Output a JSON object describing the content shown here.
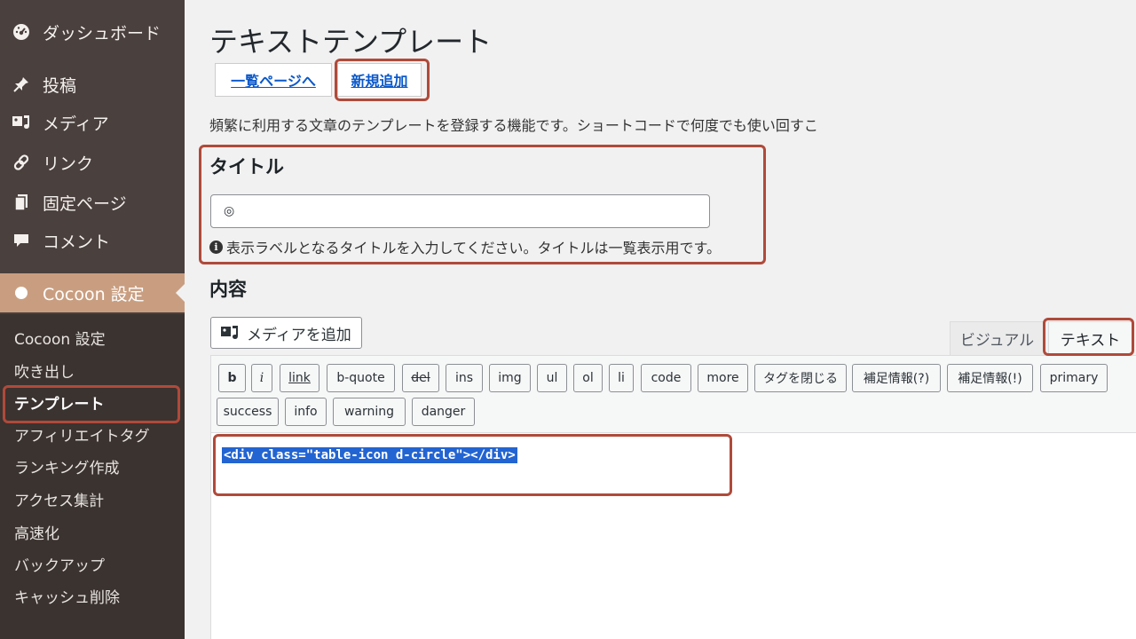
{
  "sidebar": {
    "items": [
      {
        "label": "ダッシュボード",
        "icon": "dashboard-icon"
      },
      {
        "label": "投稿",
        "icon": "pin-icon"
      },
      {
        "label": "メディア",
        "icon": "media-icon"
      },
      {
        "label": "リンク",
        "icon": "link-icon"
      },
      {
        "label": "固定ページ",
        "icon": "page-icon"
      },
      {
        "label": "コメント",
        "icon": "comment-icon"
      },
      {
        "label": "Cocoon 設定",
        "icon": "cocoon-icon"
      }
    ],
    "submenu": [
      "Cocoon 設定",
      "吹き出し",
      "テンプレート",
      "アフィリエイトタグ",
      "ランキング作成",
      "アクセス集計",
      "高速化",
      "バックアップ",
      "キャッシュ削除"
    ],
    "active_color": "#c99e80"
  },
  "main": {
    "title": "テキストテンプレート",
    "nav": {
      "list_link": "一覧ページへ",
      "add_new": "新規追加"
    },
    "description": "頻繁に利用する文章のテンプレートを登録する機能です。ショートコードで何度でも使い回すこ",
    "title_section": {
      "label": "タイトル",
      "value": "◎",
      "hint": "表示ラベルとなるタイトルを入力してください。タイトルは一覧表示用です。"
    },
    "content_section": {
      "label": "内容",
      "media_button": "メディアを追加",
      "tabs": {
        "visual": "ビジュアル",
        "text": "テキスト"
      },
      "toolbar": [
        "b",
        "i",
        "link",
        "b-quote",
        "del",
        "ins",
        "img",
        "ul",
        "ol",
        "li",
        "code",
        "more",
        "タグを閉じる",
        "補足情報(?)",
        "補足情報(!)",
        "primary",
        "success",
        "info",
        "warning",
        "danger"
      ],
      "editor_content": "<div class=\"table-icon d-circle\"></div>"
    }
  },
  "highlight_color": "#b04a3a"
}
